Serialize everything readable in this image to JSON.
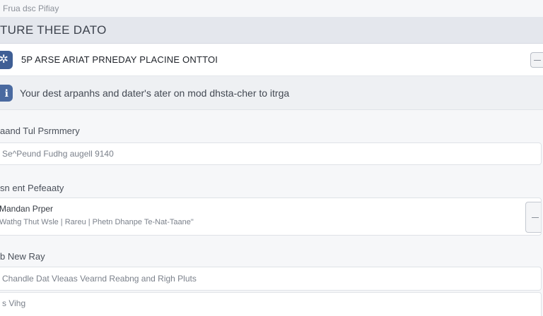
{
  "breadcrumb": "Frua dsc Pifiay",
  "section_header": "TURE THEE DATO",
  "item": {
    "icon": "asterisk-icon",
    "label": "5P ARSE ARIAT PRNEDAY PLACINE ONTTOI"
  },
  "info": {
    "icon": "info-icon",
    "text": "Your dest arpanhs and dater's ater on mod dhsta-cher to itrga"
  },
  "fields": [
    {
      "label": "aand Tul Psrmmery",
      "value": "Se^Peund Fudhg augell 9140"
    },
    {
      "label": "sn ent Pefeaaty",
      "title": "Mandan Prper",
      "value": "Wathg Thut Wsle  |  Rareu  |  Phetn Dhanpe Te-Nat-Taane\""
    },
    {
      "label": "b New Ray",
      "value": "Chandle Dat Vleaas Vearnd Reabng and Righ Pluts"
    }
  ],
  "footer_text": "s Vihg"
}
